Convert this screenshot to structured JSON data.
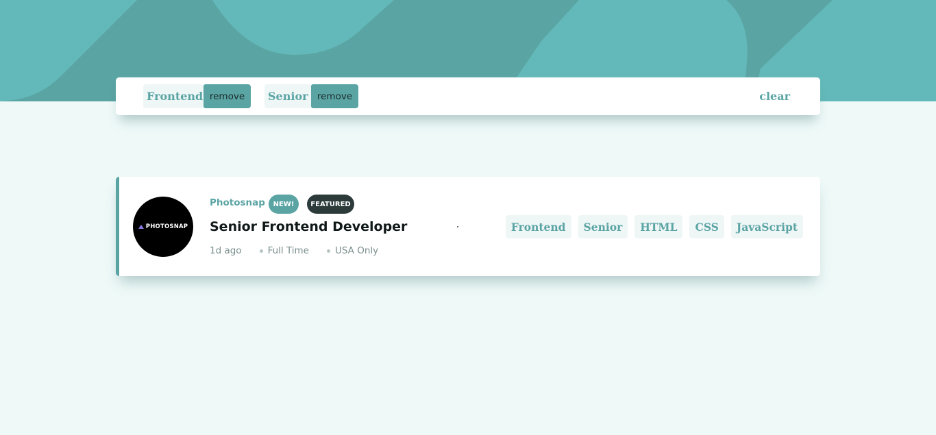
{
  "colors": {
    "primary": "#5ba4a4",
    "background": "#eef9f8",
    "header_dark": "#5a9f9f",
    "header_light": "#63baba",
    "featured_badge": "#2c3a3a",
    "tag_background": "#eef6f6"
  },
  "filter_bar": {
    "filters": [
      {
        "label": "Frontend",
        "remove_label": "remove"
      },
      {
        "label": "Senior",
        "remove_label": "remove"
      }
    ],
    "clear_label": "clear"
  },
  "jobs": [
    {
      "logo_text": "PHOTOSNAP",
      "company": "Photosnap",
      "new_badge": "NEW!",
      "featured_badge": "FEATURED",
      "position": "Senior Frontend Developer",
      "posted": "1d ago",
      "contract": "Full Time",
      "location": "USA Only",
      "tags": [
        "Frontend",
        "Senior",
        "HTML",
        "CSS",
        "JavaScript"
      ]
    }
  ]
}
